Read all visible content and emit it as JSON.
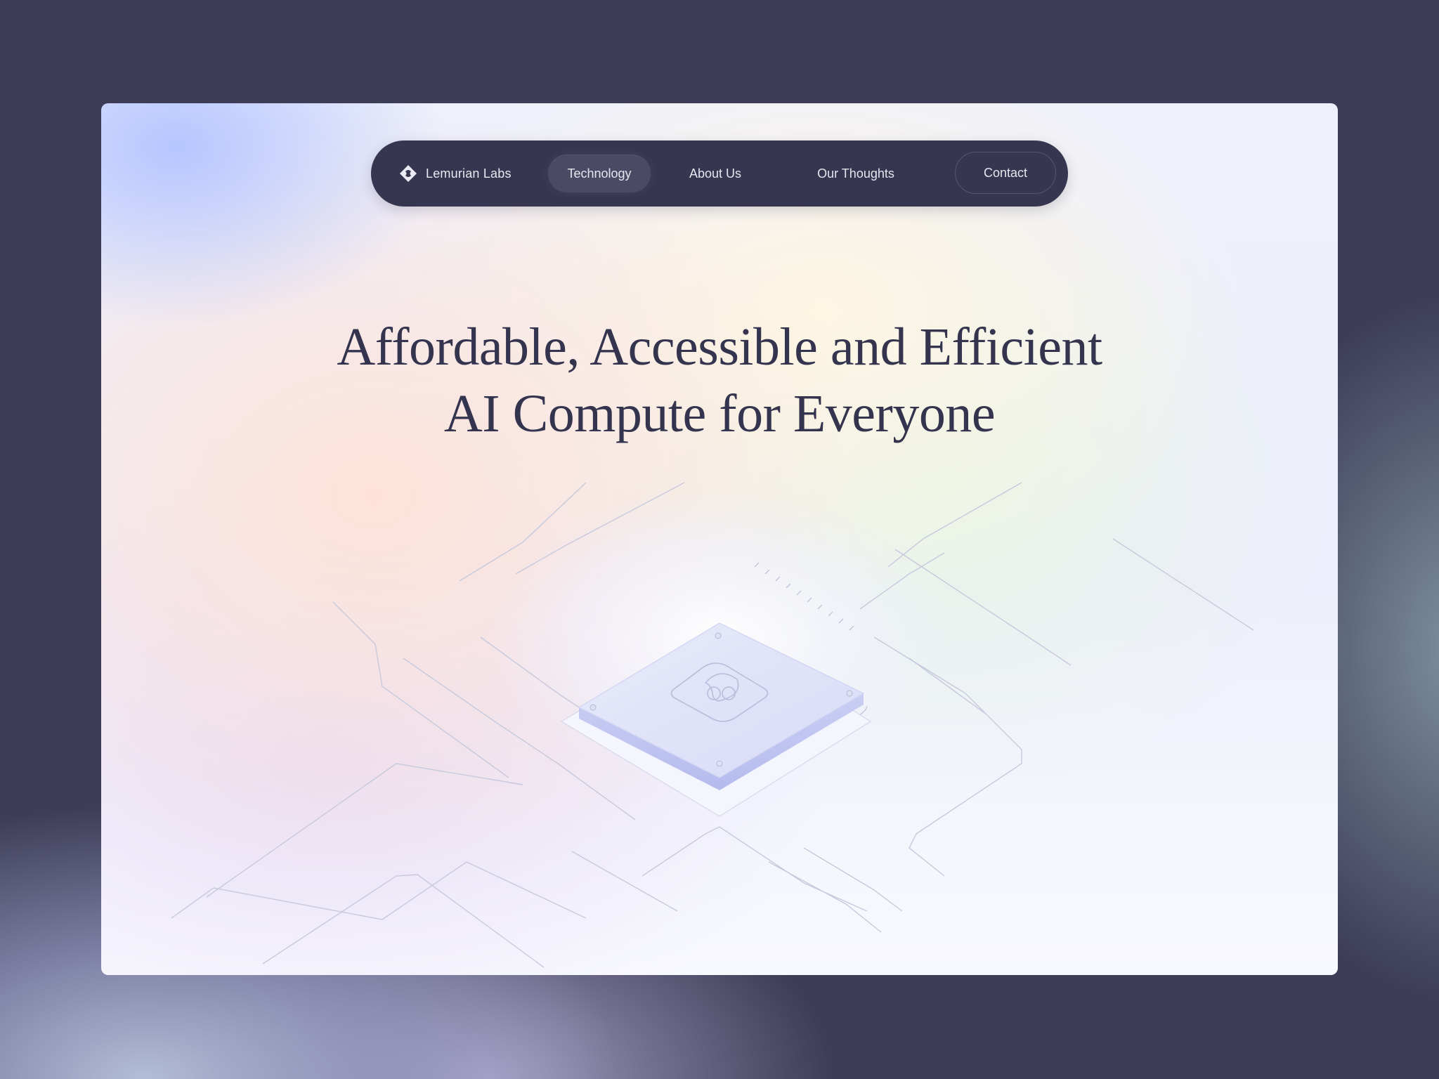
{
  "nav": {
    "brand": "Lemurian Labs",
    "brand_icon": "lemurian-logo-icon",
    "items": [
      {
        "label": "Technology",
        "active": true
      },
      {
        "label": "About Us",
        "active": false
      },
      {
        "label": "Our Thoughts",
        "active": false
      }
    ],
    "contact_label": "Contact"
  },
  "hero": {
    "line1": "Affordable, Accessible and Efficient",
    "line2": "AI Compute for Everyone"
  },
  "colors": {
    "backdrop": "#3d3d57",
    "nav_bg": "#363650",
    "heading": "#34344f",
    "chip_accent": "#b7bdf0"
  }
}
